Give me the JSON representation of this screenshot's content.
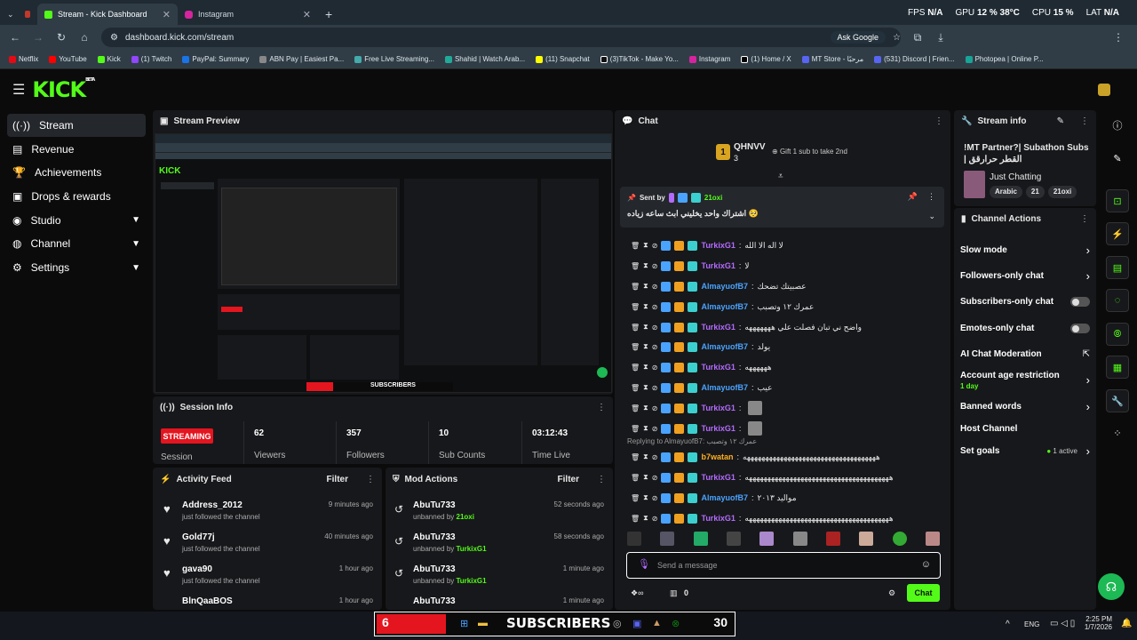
{
  "browser": {
    "tabs": [
      {
        "label": "Stream - Kick Dashboard",
        "active": true
      },
      {
        "label": "Instagram",
        "active": false
      }
    ],
    "sys": {
      "fps_label": "FPS",
      "fps": "N/A",
      "gpu_label": "GPU",
      "gpu": "12 % 38°C",
      "cpu_label": "CPU",
      "cpu": "15 %",
      "lat_label": "LAT",
      "lat": "N/A"
    },
    "url": "dashboard.kick.com/stream",
    "ask_google": "Ask Google",
    "bookmarks": [
      "Netflix",
      "YouTube",
      "Kick",
      "(1) Twitch",
      "PayPal: Summary",
      "ABN Pay | Easiest Pa...",
      "Free Live Streaming...",
      "Shahid | Watch Arab...",
      "(11) Snapchat",
      "(3)TikTok - Make Yo...",
      "Instagram",
      "(1) Home / X",
      "MT Store - مرحبًا",
      "(531) Discord | Frien...",
      "Photopea | Online P..."
    ]
  },
  "logo": "KICK",
  "logo_badge": "BETA",
  "sidebar": {
    "items": [
      {
        "label": "Stream",
        "icon": "broadcast-icon"
      },
      {
        "label": "Revenue",
        "icon": "revenue-icon"
      },
      {
        "label": "Achievements",
        "icon": "trophy-icon"
      },
      {
        "label": "Drops & rewards",
        "icon": "gift-icon"
      },
      {
        "label": "Studio",
        "icon": "studio-icon"
      },
      {
        "label": "Channel",
        "icon": "channel-icon"
      },
      {
        "label": "Settings",
        "icon": "gear-icon"
      }
    ]
  },
  "preview": {
    "title": "Stream Preview"
  },
  "session": {
    "title": "Session Info",
    "status": "STREAMING",
    "status_label": "Session",
    "stats": [
      {
        "value": "62",
        "label": "Viewers"
      },
      {
        "value": "357",
        "label": "Followers"
      },
      {
        "value": "10",
        "label": "Sub Counts"
      },
      {
        "value": "03:12:43",
        "label": "Time Live"
      }
    ]
  },
  "activity": {
    "title": "Activity Feed",
    "filter": "Filter",
    "items": [
      {
        "name": "Address_2012",
        "action": "just followed the channel",
        "time": "9 minutes ago"
      },
      {
        "name": "Gold77j",
        "action": "just followed the channel",
        "time": "40 minutes ago"
      },
      {
        "name": "gava90",
        "action": "just followed the channel",
        "time": "1 hour ago"
      },
      {
        "name": "BlnQaaBOS",
        "action": "",
        "time": "1 hour ago"
      }
    ]
  },
  "mod": {
    "title": "Mod Actions",
    "filter": "Filter",
    "items": [
      {
        "name": "AbuTu733",
        "action": "unbanned by",
        "by": "21oxi",
        "time": "52 seconds ago"
      },
      {
        "name": "AbuTu733",
        "action": "unbanned by",
        "by": "TurkixG1",
        "time": "58 seconds ago"
      },
      {
        "name": "AbuTu733",
        "action": "unbanned by",
        "by": "TurkixG1",
        "time": "1 minute ago"
      },
      {
        "name": "AbuTu733",
        "action": "",
        "by": "",
        "time": "1 minute ago"
      }
    ]
  },
  "chat": {
    "title": "Chat",
    "top_gifter": {
      "name": "QHNVV",
      "count": "3",
      "gift_text": "Gift 1 sub to take 2nd"
    },
    "pinned": {
      "label": "Sent by",
      "user": "21oxi",
      "text": "اشتراك واحد يخليني ابث ساعه زياده 🥺"
    },
    "replying": "Replying to AlmayuofB7: عمرك ١٢ وتصبب",
    "messages": [
      {
        "user": "TurkixG1",
        "color": "#b36bff",
        "text": "لا اله الا الله"
      },
      {
        "user": "TurkixG1",
        "color": "#b36bff",
        "text": "لا"
      },
      {
        "user": "AlmayuofB7",
        "color": "#4aa3ff",
        "text": "عصبيتك تضحك"
      },
      {
        "user": "AlmayuofB7",
        "color": "#4aa3ff",
        "text": "عمرك ١٢ وتصبب"
      },
      {
        "user": "TurkixG1",
        "color": "#b36bff",
        "text": "واضح ني تبان فصلت علي هههههههه"
      },
      {
        "user": "AlmayuofB7",
        "color": "#4aa3ff",
        "text": "يولد"
      },
      {
        "user": "TurkixG1",
        "color": "#b36bff",
        "text": "ههههههه"
      },
      {
        "user": "AlmayuofB7",
        "color": "#4aa3ff",
        "text": "عيب"
      },
      {
        "user": "TurkixG1",
        "color": "#b36bff",
        "text": ""
      },
      {
        "user": "TurkixG1",
        "color": "#b36bff",
        "text": ""
      },
      {
        "user": "b7watan",
        "color": "#ffb020",
        "text": "ههههههههههههههههههههههههههههههههههههه"
      },
      {
        "user": "TurkixG1",
        "color": "#b36bff",
        "text": "هههههههههههههههههههههههههههههههههههههههه"
      },
      {
        "user": "AlmayuofB7",
        "color": "#4aa3ff",
        "text": "مواليد ٢٠١٣"
      },
      {
        "user": "TurkixG1",
        "color": "#b36bff",
        "text": "هههههههههههههههههههههههههههههههههههههههه"
      }
    ],
    "placeholder": "Send a message",
    "points": "0",
    "send": "Chat"
  },
  "stream_info": {
    "title": "Stream info",
    "stream_title": "!MT Partner?| Subathon Subs | القطر حرارقق",
    "category": "Just Chatting",
    "tags": [
      "Arabic",
      "21",
      "21oxi"
    ]
  },
  "channel_actions": {
    "title": "Channel Actions",
    "items": [
      {
        "label": "Slow mode",
        "kind": "arrow"
      },
      {
        "label": "Followers-only chat",
        "kind": "arrow"
      },
      {
        "label": "Subscribers-only chat",
        "kind": "toggle"
      },
      {
        "label": "Emotes-only chat",
        "kind": "toggle"
      },
      {
        "label": "AI Chat Moderation",
        "kind": "external"
      },
      {
        "label": "Account age restriction",
        "sub": "1 day",
        "kind": "arrow"
      },
      {
        "label": "Banned words",
        "kind": "arrow"
      },
      {
        "label": "Host Channel",
        "kind": "none"
      },
      {
        "label": "Set goals",
        "sub": "1 active",
        "kind": "arrow"
      }
    ]
  },
  "overlay": {
    "left": "6",
    "label": "SUBSCRIBERS",
    "right": "30"
  },
  "taskbar": {
    "lang": "ENG",
    "time": "2:25 PM",
    "date": "1/7/2026"
  },
  "colors": {
    "accent": "#53fc18",
    "streaming": "#e4151f"
  }
}
